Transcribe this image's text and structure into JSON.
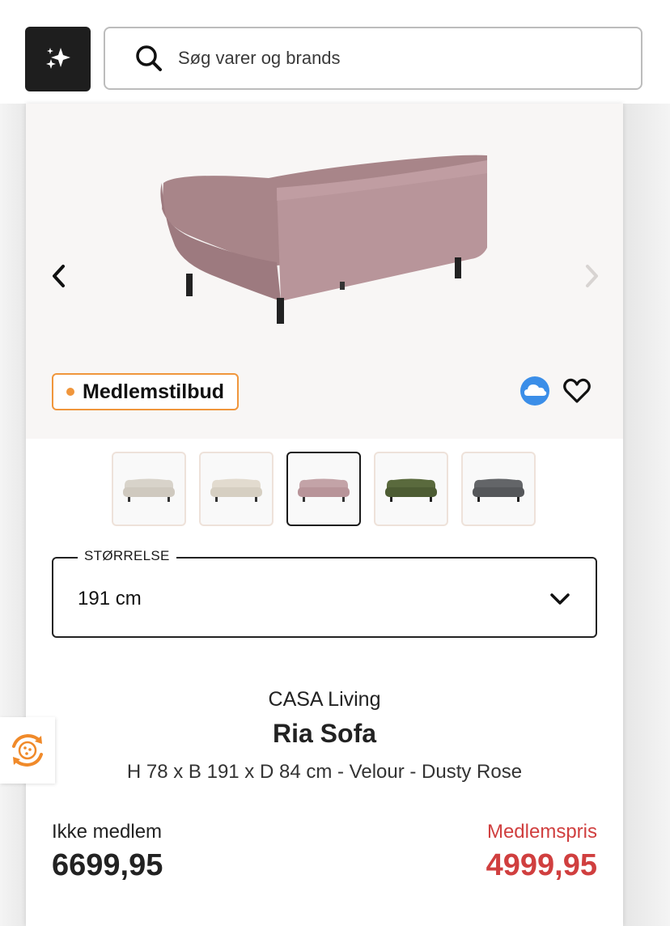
{
  "header": {
    "ai_icon": "sparkles-icon",
    "search": {
      "icon": "search-icon",
      "placeholder": "Søg varer og brands"
    }
  },
  "gallery": {
    "prev_icon": "chevron-left-icon",
    "next_icon": "chevron-right-icon",
    "badge": "Medlemstilbud",
    "badge_color": "#f0963c",
    "thumbnails": [
      {
        "name": "beige-sofa",
        "color": "#d8d3ca",
        "selected": false
      },
      {
        "name": "cream-sofa",
        "color": "#e2dbcf",
        "selected": false
      },
      {
        "name": "rose-sofa",
        "color": "#b89499",
        "selected": true
      },
      {
        "name": "green-sofa",
        "color": "#4d5c33",
        "selected": false
      },
      {
        "name": "grey-sofa",
        "color": "#55575a",
        "selected": false
      }
    ]
  },
  "size_select": {
    "label": "STØRRELSE",
    "value": "191 cm"
  },
  "product": {
    "brand": "CASA Living",
    "name": "Ria Sofa",
    "description": "H 78 x B 191 x D 84 cm - Velour - Dusty Rose"
  },
  "pricing": {
    "non_member_label": "Ikke medlem",
    "non_member_price": "6699,95",
    "member_label": "Medlemspris",
    "member_price": "4999,95",
    "member_color": "#d03f3f"
  }
}
